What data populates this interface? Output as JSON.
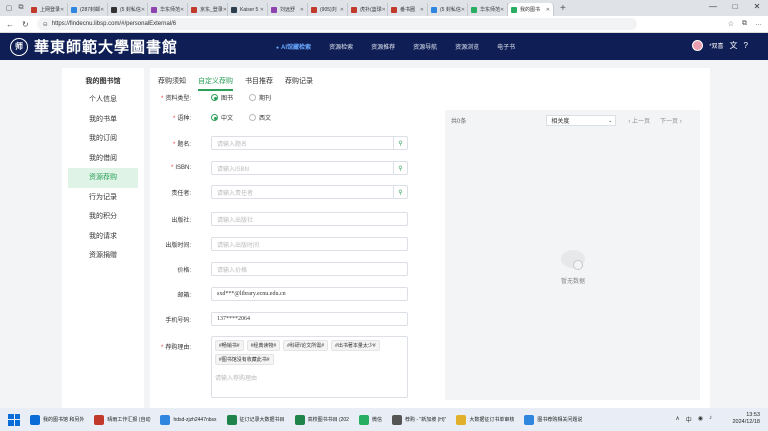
{
  "browser": {
    "tabs": [
      {
        "title": "上网登录",
        "color": "#c0392b"
      },
      {
        "title": "(287封邮",
        "color": "#2e86de"
      },
      {
        "title": "(5 封私信",
        "color": "#333"
      },
      {
        "title": "华东师范",
        "color": "#8e44ad"
      },
      {
        "title": "京东_登录",
        "color": "#c0392b"
      },
      {
        "title": "Kaiser 5",
        "color": "#2c3e50"
      },
      {
        "title": "刘远舒",
        "color": "#8e44ad"
      },
      {
        "title": "(905)刘",
        "color": "#c0392b"
      },
      {
        "title": "虎扑(篮球",
        "color": "#c0392b"
      },
      {
        "title": "番书圈",
        "color": "#c0392b"
      },
      {
        "title": "(5 封私信",
        "color": "#2e86de"
      },
      {
        "title": "华东师范",
        "color": "#27ae60"
      },
      {
        "title": "我的图书",
        "color": "#27ae60"
      }
    ],
    "active_tab": 12,
    "url": "https://findecnu.libsp.com/#/personalExternal/6",
    "window_controls": [
      "—",
      "□",
      "✕"
    ]
  },
  "header": {
    "logo_seal": "师",
    "logo_text": "華東師範大學圖書館",
    "nav": [
      "AI馆藏检索",
      "资源检索",
      "资源推荐",
      "资源导航",
      "资源浏览",
      "电子书"
    ],
    "user_name": "*双喜",
    "icon_translate": "文",
    "icon_help": "?"
  },
  "sidebar": {
    "title": "我的图书馆",
    "items": [
      "个人信息",
      "我的书单",
      "我的订阅",
      "我的借阅",
      "资源荐购",
      "行为记录",
      "我的积分",
      "我的请求",
      "资源捐赠"
    ],
    "active": 4
  },
  "main": {
    "tabs": [
      "荐购须知",
      "自定义荐购",
      "书目推荐",
      "荐购记录"
    ],
    "active_tab": 1,
    "form": {
      "type_label": "资料类型:",
      "type_options": [
        "图书",
        "期刊"
      ],
      "lang_label": "语种:",
      "lang_options": [
        "中文",
        "西文"
      ],
      "title_label": "题名:",
      "title_placeholder": "请输入题名",
      "isbn_label": "ISBN:",
      "isbn_placeholder": "请输入ISBN",
      "author_label": "责任者:",
      "author_placeholder": "请输入责任者",
      "publisher_label": "出版社:",
      "publisher_placeholder": "请输入出版社",
      "pubdate_label": "出版时间:",
      "pubdate_placeholder": "请输入出版时间",
      "price_label": "价格:",
      "price_placeholder": "请输入价格",
      "email_label": "邮箱:",
      "email_value": "sxd***@library.ecnu.edu.cn",
      "phone_label": "手机号码:",
      "phone_value": "137****2064",
      "reason_label": "荐购理由:",
      "reason_tags": [
        "#畅销书#",
        "#经典读物#",
        "#科研/论文所需#",
        "#出书著本量太少#",
        "#图书馆没有收藏此书#"
      ],
      "reason_placeholder": "请输入荐购理由"
    },
    "results": {
      "count": "共0条",
      "sort": "相关度",
      "prev": "上一页",
      "next": "下一页",
      "empty": "暂无数据"
    }
  },
  "taskbar": {
    "items": [
      {
        "label": "我的图书馆 和另外",
        "color": "#0a6cd6"
      },
      {
        "label": "晴雨工作汇报 (自动",
        "color": "#c0392b"
      },
      {
        "label": "hdsd-zjzh2447nbsx",
        "color": "#2e86de"
      },
      {
        "label": "征订记录大数据书目",
        "color": "#1e8449"
      },
      {
        "label": "高校图书书目 (202",
        "color": "#1e8449"
      },
      {
        "label": "微信",
        "color": "#27ae60"
      },
      {
        "label": "荐购 - \"新加坡 (H)\"",
        "color": "#555"
      },
      {
        "label": "大数据征订书单审核",
        "color": "#e1b12c"
      },
      {
        "label": "图书荐购相关问题说",
        "color": "#2e86de"
      }
    ],
    "tray": [
      "∧",
      "中",
      "◉",
      "♪"
    ],
    "time": "13:53",
    "date": "2024/12/18"
  }
}
